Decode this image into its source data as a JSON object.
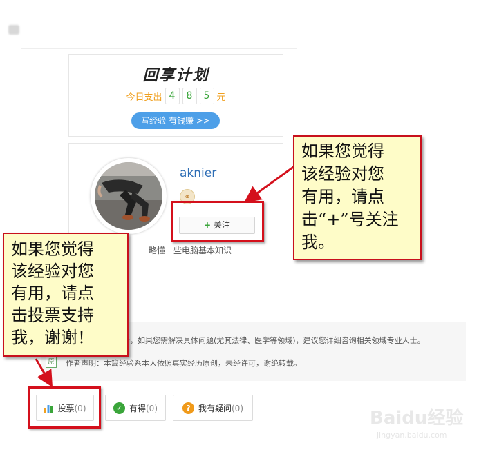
{
  "plan_card": {
    "title": "回享计划",
    "expense_prefix": "今日支出",
    "digits": [
      "4",
      "8",
      "5"
    ],
    "expense_suffix": "元",
    "write_button": "写经验 有钱赚 >>"
  },
  "author": {
    "username": "aknier",
    "follow_label": "关注",
    "bio": "略懂一些电脑基本知识"
  },
  "notices": {
    "advice_text": "者，如果您需解决具体问题(尤其法律、医学等领域)，建议您详细咨询相关领域专业人士。",
    "original_tag": "原",
    "declaration": "作者声明：本篇经验系本人依照真实经历原创，未经许可，谢绝转载。"
  },
  "actions": {
    "vote_label": "投票",
    "vote_count": "(0)",
    "useful_label": "有得",
    "useful_count": "(0)",
    "ask_label": "我有疑问",
    "ask_count": "(0)"
  },
  "callouts": {
    "right_lines": [
      "如果您觉得",
      "该经验对您",
      "有用，请点",
      "击“+”号关注",
      "我。"
    ],
    "left_lines": [
      "如果您觉得",
      "该经验对您",
      "有用，请点",
      "击投票支持",
      "我，谢谢！"
    ]
  },
  "watermark": {
    "logo": "Baidu经验",
    "url": "jingyan.baidu.com"
  },
  "colors": {
    "accent_blue": "#4d9fe8",
    "digit_green": "#3aa53a",
    "expense_orange": "#f0a020",
    "callout_fill": "#fefcc8",
    "callout_border": "#c8101c"
  }
}
